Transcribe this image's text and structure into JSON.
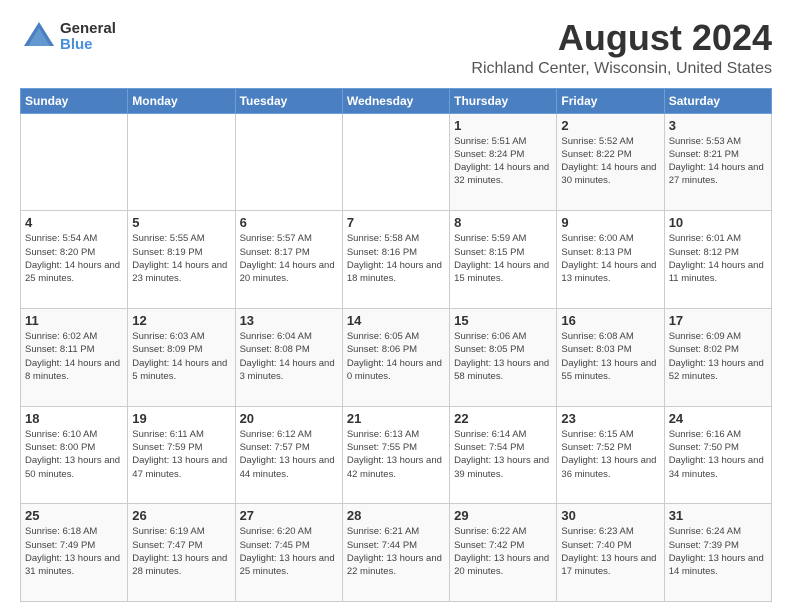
{
  "logo": {
    "general": "General",
    "blue": "Blue"
  },
  "title": "August 2024",
  "subtitle": "Richland Center, Wisconsin, United States",
  "days_of_week": [
    "Sunday",
    "Monday",
    "Tuesday",
    "Wednesday",
    "Thursday",
    "Friday",
    "Saturday"
  ],
  "weeks": [
    [
      {
        "day": "",
        "sunrise": "",
        "sunset": "",
        "daylight": ""
      },
      {
        "day": "",
        "sunrise": "",
        "sunset": "",
        "daylight": ""
      },
      {
        "day": "",
        "sunrise": "",
        "sunset": "",
        "daylight": ""
      },
      {
        "day": "",
        "sunrise": "",
        "sunset": "",
        "daylight": ""
      },
      {
        "day": "1",
        "sunrise": "Sunrise: 5:51 AM",
        "sunset": "Sunset: 8:24 PM",
        "daylight": "Daylight: 14 hours and 32 minutes."
      },
      {
        "day": "2",
        "sunrise": "Sunrise: 5:52 AM",
        "sunset": "Sunset: 8:22 PM",
        "daylight": "Daylight: 14 hours and 30 minutes."
      },
      {
        "day": "3",
        "sunrise": "Sunrise: 5:53 AM",
        "sunset": "Sunset: 8:21 PM",
        "daylight": "Daylight: 14 hours and 27 minutes."
      }
    ],
    [
      {
        "day": "4",
        "sunrise": "Sunrise: 5:54 AM",
        "sunset": "Sunset: 8:20 PM",
        "daylight": "Daylight: 14 hours and 25 minutes."
      },
      {
        "day": "5",
        "sunrise": "Sunrise: 5:55 AM",
        "sunset": "Sunset: 8:19 PM",
        "daylight": "Daylight: 14 hours and 23 minutes."
      },
      {
        "day": "6",
        "sunrise": "Sunrise: 5:57 AM",
        "sunset": "Sunset: 8:17 PM",
        "daylight": "Daylight: 14 hours and 20 minutes."
      },
      {
        "day": "7",
        "sunrise": "Sunrise: 5:58 AM",
        "sunset": "Sunset: 8:16 PM",
        "daylight": "Daylight: 14 hours and 18 minutes."
      },
      {
        "day": "8",
        "sunrise": "Sunrise: 5:59 AM",
        "sunset": "Sunset: 8:15 PM",
        "daylight": "Daylight: 14 hours and 15 minutes."
      },
      {
        "day": "9",
        "sunrise": "Sunrise: 6:00 AM",
        "sunset": "Sunset: 8:13 PM",
        "daylight": "Daylight: 14 hours and 13 minutes."
      },
      {
        "day": "10",
        "sunrise": "Sunrise: 6:01 AM",
        "sunset": "Sunset: 8:12 PM",
        "daylight": "Daylight: 14 hours and 11 minutes."
      }
    ],
    [
      {
        "day": "11",
        "sunrise": "Sunrise: 6:02 AM",
        "sunset": "Sunset: 8:11 PM",
        "daylight": "Daylight: 14 hours and 8 minutes."
      },
      {
        "day": "12",
        "sunrise": "Sunrise: 6:03 AM",
        "sunset": "Sunset: 8:09 PM",
        "daylight": "Daylight: 14 hours and 5 minutes."
      },
      {
        "day": "13",
        "sunrise": "Sunrise: 6:04 AM",
        "sunset": "Sunset: 8:08 PM",
        "daylight": "Daylight: 14 hours and 3 minutes."
      },
      {
        "day": "14",
        "sunrise": "Sunrise: 6:05 AM",
        "sunset": "Sunset: 8:06 PM",
        "daylight": "Daylight: 14 hours and 0 minutes."
      },
      {
        "day": "15",
        "sunrise": "Sunrise: 6:06 AM",
        "sunset": "Sunset: 8:05 PM",
        "daylight": "Daylight: 13 hours and 58 minutes."
      },
      {
        "day": "16",
        "sunrise": "Sunrise: 6:08 AM",
        "sunset": "Sunset: 8:03 PM",
        "daylight": "Daylight: 13 hours and 55 minutes."
      },
      {
        "day": "17",
        "sunrise": "Sunrise: 6:09 AM",
        "sunset": "Sunset: 8:02 PM",
        "daylight": "Daylight: 13 hours and 52 minutes."
      }
    ],
    [
      {
        "day": "18",
        "sunrise": "Sunrise: 6:10 AM",
        "sunset": "Sunset: 8:00 PM",
        "daylight": "Daylight: 13 hours and 50 minutes."
      },
      {
        "day": "19",
        "sunrise": "Sunrise: 6:11 AM",
        "sunset": "Sunset: 7:59 PM",
        "daylight": "Daylight: 13 hours and 47 minutes."
      },
      {
        "day": "20",
        "sunrise": "Sunrise: 6:12 AM",
        "sunset": "Sunset: 7:57 PM",
        "daylight": "Daylight: 13 hours and 44 minutes."
      },
      {
        "day": "21",
        "sunrise": "Sunrise: 6:13 AM",
        "sunset": "Sunset: 7:55 PM",
        "daylight": "Daylight: 13 hours and 42 minutes."
      },
      {
        "day": "22",
        "sunrise": "Sunrise: 6:14 AM",
        "sunset": "Sunset: 7:54 PM",
        "daylight": "Daylight: 13 hours and 39 minutes."
      },
      {
        "day": "23",
        "sunrise": "Sunrise: 6:15 AM",
        "sunset": "Sunset: 7:52 PM",
        "daylight": "Daylight: 13 hours and 36 minutes."
      },
      {
        "day": "24",
        "sunrise": "Sunrise: 6:16 AM",
        "sunset": "Sunset: 7:50 PM",
        "daylight": "Daylight: 13 hours and 34 minutes."
      }
    ],
    [
      {
        "day": "25",
        "sunrise": "Sunrise: 6:18 AM",
        "sunset": "Sunset: 7:49 PM",
        "daylight": "Daylight: 13 hours and 31 minutes."
      },
      {
        "day": "26",
        "sunrise": "Sunrise: 6:19 AM",
        "sunset": "Sunset: 7:47 PM",
        "daylight": "Daylight: 13 hours and 28 minutes."
      },
      {
        "day": "27",
        "sunrise": "Sunrise: 6:20 AM",
        "sunset": "Sunset: 7:45 PM",
        "daylight": "Daylight: 13 hours and 25 minutes."
      },
      {
        "day": "28",
        "sunrise": "Sunrise: 6:21 AM",
        "sunset": "Sunset: 7:44 PM",
        "daylight": "Daylight: 13 hours and 22 minutes."
      },
      {
        "day": "29",
        "sunrise": "Sunrise: 6:22 AM",
        "sunset": "Sunset: 7:42 PM",
        "daylight": "Daylight: 13 hours and 20 minutes."
      },
      {
        "day": "30",
        "sunrise": "Sunrise: 6:23 AM",
        "sunset": "Sunset: 7:40 PM",
        "daylight": "Daylight: 13 hours and 17 minutes."
      },
      {
        "day": "31",
        "sunrise": "Sunrise: 6:24 AM",
        "sunset": "Sunset: 7:39 PM",
        "daylight": "Daylight: 13 hours and 14 minutes."
      }
    ]
  ]
}
